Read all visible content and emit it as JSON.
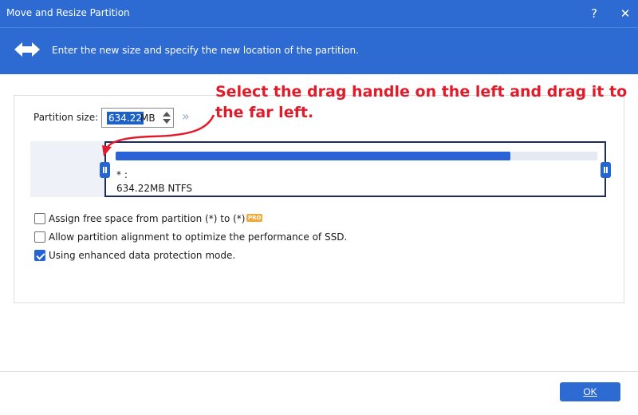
{
  "window": {
    "title": "Move and Resize Partition",
    "help_label": "?",
    "close_label": "✕"
  },
  "banner": {
    "icon": "left-right-arrow-icon",
    "text": "Enter the new size and specify the new location of the partition."
  },
  "partition_size": {
    "label": "Partition size:",
    "value": "634.22",
    "unit": "MB",
    "expand_icon": "double-chevron-right-icon",
    "expand_label": "»"
  },
  "partition": {
    "name": "* :",
    "info": "634.22MB NTFS",
    "used_fraction": 0.82
  },
  "options": [
    {
      "label": "Assign free space from partition (*) to (*)",
      "checked": false,
      "badge": "PRO"
    },
    {
      "label": "Allow partition alignment to optimize the performance of SSD.",
      "checked": false
    },
    {
      "label": "Using enhanced data protection mode.",
      "checked": true
    }
  ],
  "annotation": {
    "text": "Select the drag handle on the left and drag it to the far left.",
    "color": "#e21b2a"
  },
  "footer": {
    "ok_label": "OK"
  },
  "colors": {
    "accent": "#2d6ad2",
    "bar_fill": "#2a62d8",
    "partition_border": "#1d2b64",
    "pro_badge": "#f2a93b"
  }
}
